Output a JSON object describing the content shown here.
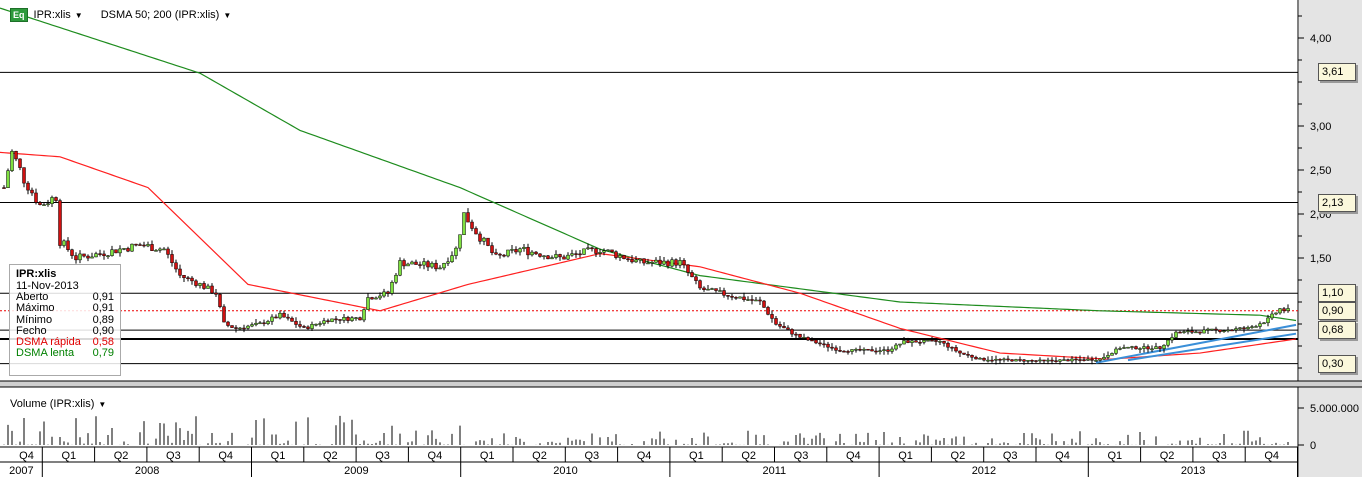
{
  "header": {
    "symbol": "IPR:xlis",
    "indicator": "DSMA 50; 200 (IPR:xlis)",
    "eq_badge": "Eq"
  },
  "tooltip": {
    "title": "IPR:xlis",
    "date": "11-Nov-2013",
    "rows": [
      {
        "label": "Aberto",
        "value": "0,91",
        "color": "#000000"
      },
      {
        "label": "Máximo",
        "value": "0,91",
        "color": "#000000"
      },
      {
        "label": "Mínimo",
        "value": "0,89",
        "color": "#000000"
      },
      {
        "label": "Fecho",
        "value": "0,90",
        "color": "#000000"
      },
      {
        "label": "DSMA rápida",
        "value": "0,58",
        "color": "#e00000"
      },
      {
        "label": "DSMA lenta",
        "value": "0,79",
        "color": "#008000"
      }
    ]
  },
  "volume": {
    "title": "Volume (IPR:xlis)",
    "axis": [
      "5.000.000",
      "0"
    ]
  },
  "price_axis": [
    "4,00",
    "3,00",
    "2,50",
    "2,00",
    "1,50"
  ],
  "level_labels": [
    {
      "value": 3.61,
      "text": "3,61"
    },
    {
      "value": 2.13,
      "text": "2,13"
    },
    {
      "value": 1.1,
      "text": "1,10"
    },
    {
      "value": 0.9,
      "text": "0,90"
    },
    {
      "value": 0.68,
      "text": "0,68"
    },
    {
      "value": 0.3,
      "text": "0,30"
    }
  ],
  "time_axis": {
    "years": [
      "2007",
      "2008",
      "2009",
      "2010",
      "2011",
      "2012",
      "2013"
    ],
    "quarters": [
      "Q4",
      "Q1",
      "Q2",
      "Q3",
      "Q4",
      "Q1",
      "Q2",
      "Q3",
      "Q4",
      "Q1",
      "Q2",
      "Q3",
      "Q4",
      "Q1",
      "Q2",
      "Q3",
      "Q4",
      "Q1",
      "Q2",
      "Q3",
      "Q4",
      "Q1",
      "Q2",
      "Q3",
      "Q4"
    ]
  },
  "chart_data": {
    "type": "candlestick",
    "price_range": [
      0,
      4.4
    ],
    "close_keypoints_week_price": [
      [
        1,
        2.3
      ],
      [
        3,
        2.7
      ],
      [
        6,
        2.4
      ],
      [
        10,
        2.1
      ],
      [
        14,
        2.2
      ],
      [
        15,
        1.7
      ],
      [
        19,
        1.5
      ],
      [
        25,
        1.55
      ],
      [
        35,
        1.65
      ],
      [
        41,
        1.6
      ],
      [
        45,
        1.3
      ],
      [
        50,
        1.2
      ],
      [
        54,
        1.1
      ],
      [
        56,
        0.75
      ],
      [
        59,
        0.7
      ],
      [
        65,
        0.75
      ],
      [
        70,
        0.85
      ],
      [
        76,
        0.7
      ],
      [
        82,
        0.8
      ],
      [
        90,
        0.82
      ],
      [
        92,
        1.05
      ],
      [
        97,
        1.1
      ],
      [
        100,
        1.45
      ],
      [
        110,
        1.4
      ],
      [
        114,
        1.6
      ],
      [
        116,
        2.0
      ],
      [
        119,
        1.8
      ],
      [
        124,
        1.5
      ],
      [
        130,
        1.6
      ],
      [
        140,
        1.5
      ],
      [
        150,
        1.6
      ],
      [
        160,
        1.45
      ],
      [
        170,
        1.45
      ],
      [
        175,
        1.15
      ],
      [
        190,
        1.0
      ],
      [
        194,
        0.75
      ],
      [
        200,
        0.6
      ],
      [
        210,
        0.45
      ],
      [
        222,
        0.45
      ],
      [
        226,
        0.55
      ],
      [
        235,
        0.55
      ],
      [
        240,
        0.42
      ],
      [
        245,
        0.35
      ],
      [
        260,
        0.33
      ],
      [
        275,
        0.35
      ],
      [
        280,
        0.48
      ],
      [
        290,
        0.48
      ],
      [
        294,
        0.65
      ],
      [
        312,
        0.7
      ],
      [
        317,
        0.8
      ],
      [
        320,
        0.92
      ],
      [
        322,
        0.9
      ]
    ],
    "sma_slow_keypoints": [
      [
        0,
        4.34
      ],
      [
        50,
        3.6
      ],
      [
        75,
        2.95
      ],
      [
        115,
        2.3
      ],
      [
        150,
        1.6
      ],
      [
        175,
        1.3
      ],
      [
        225,
        1.0
      ],
      [
        275,
        0.9
      ],
      [
        315,
        0.85
      ],
      [
        324,
        0.79
      ]
    ],
    "sma_fast_keypoints": [
      [
        0,
        2.7
      ],
      [
        15,
        2.65
      ],
      [
        37,
        2.3
      ],
      [
        62,
        1.2
      ],
      [
        95,
        0.9
      ],
      [
        117,
        1.2
      ],
      [
        150,
        1.55
      ],
      [
        175,
        1.4
      ],
      [
        200,
        1.1
      ],
      [
        225,
        0.7
      ],
      [
        250,
        0.42
      ],
      [
        277,
        0.35
      ],
      [
        300,
        0.42
      ],
      [
        324,
        0.58
      ]
    ],
    "trendline": [
      [
        274,
        0.31
      ],
      [
        324,
        0.74
      ]
    ],
    "levels": [
      3.61,
      2.13,
      1.1,
      0.68,
      0.58,
      0.3
    ],
    "last_price": 0.9
  },
  "colors": {
    "up": "#7fe040",
    "down": "#d01010",
    "fast": "#ff2020",
    "slow": "#1e8c1e",
    "trend": "#3a8fd8"
  }
}
